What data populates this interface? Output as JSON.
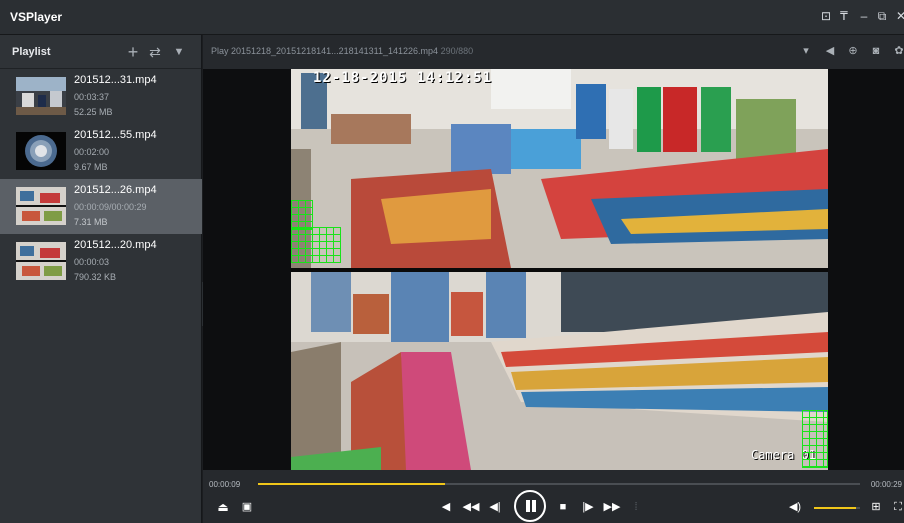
{
  "app": {
    "title": "VSPlayer"
  },
  "window_controls": {
    "items": [
      {
        "name": "minimize-to-tray-icon",
        "glyph": "⊡"
      },
      {
        "name": "pin-icon",
        "glyph": "₸"
      },
      {
        "name": "minimize-icon",
        "glyph": "–"
      },
      {
        "name": "restore-icon",
        "glyph": "⧉"
      },
      {
        "name": "close-icon",
        "glyph": "✕"
      }
    ]
  },
  "playlist": {
    "title": "Playlist",
    "add_icon": "+",
    "loop_icon": "⇄",
    "filter_icon": "▼",
    "items": [
      {
        "name": "201512...31.mp4",
        "duration": "00:03:37",
        "size": "52.25 MB",
        "selected": false
      },
      {
        "name": "201512...55.mp4",
        "duration": "00:02:00",
        "size": "9.67 MB",
        "selected": false
      },
      {
        "name": "201512...26.mp4",
        "duration": "00:00:09/00:00:29",
        "size": "7.31 MB",
        "selected": true
      },
      {
        "name": "201512...20.mp4",
        "duration": "00:00:03",
        "size": "790.32 KB",
        "selected": false
      }
    ]
  },
  "infobar": {
    "play_text": "Play 20151218_20151218141...218141311_141226.mp4",
    "frame_counter": "290/880"
  },
  "video": {
    "osd_timestamp": "12-18-2015 14:12:51",
    "osd_camera": "Camera 01"
  },
  "progress": {
    "current_time": "00:00:09",
    "total_time": "00:00:29",
    "fraction": 0.31
  },
  "volume": {
    "fraction": 0.92
  },
  "colors": {
    "accent": "#f0c61a",
    "selected_item": "#5b6066",
    "motion_grid": "#19e319"
  }
}
